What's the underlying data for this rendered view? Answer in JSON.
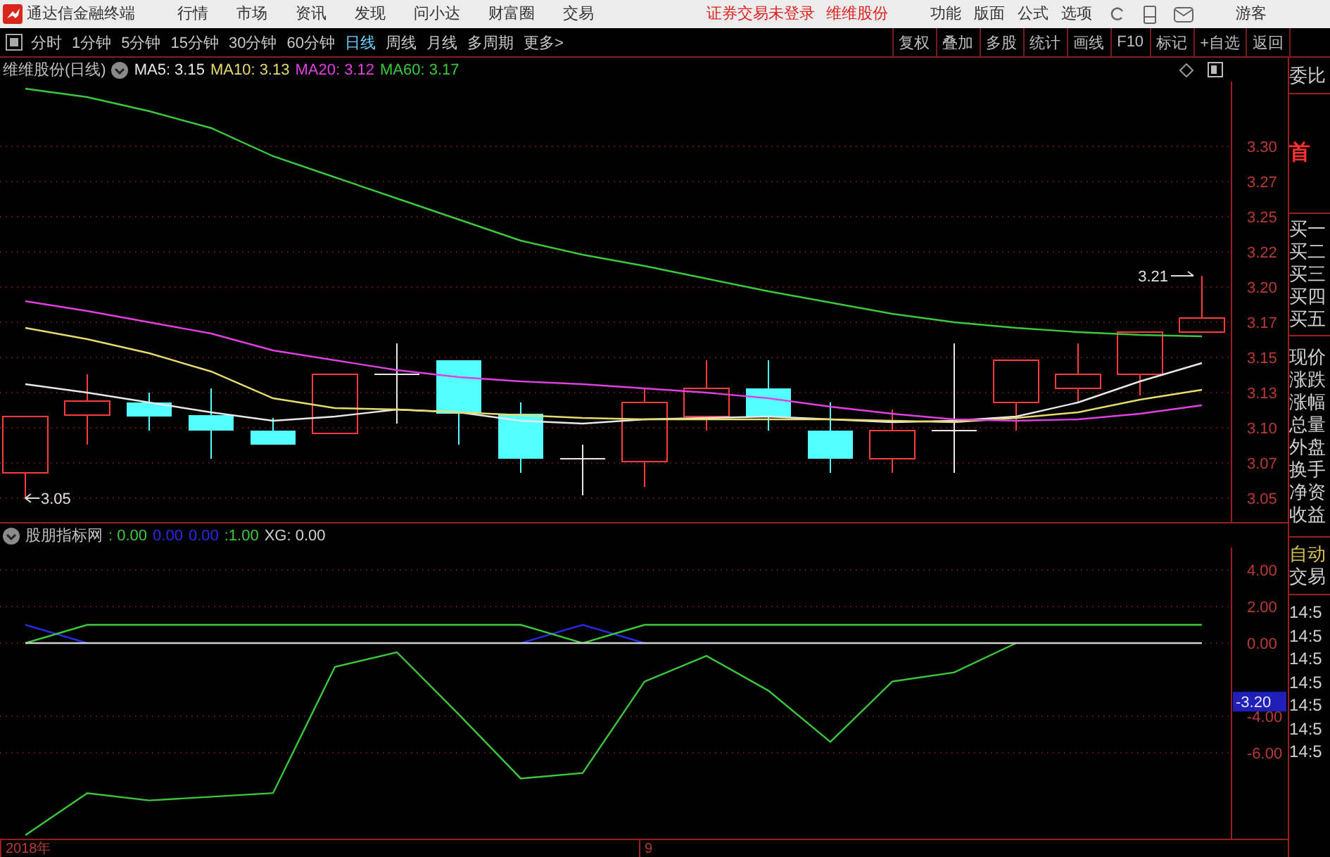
{
  "title_bar": {
    "app_name": "通达信金融终端",
    "menu": [
      "行情",
      "市场",
      "资讯",
      "发现",
      "问小达",
      "财富圈",
      "交易"
    ],
    "status": [
      "证券交易未登录",
      "维维股份"
    ],
    "right_menu": [
      "功能",
      "版面",
      "公式",
      "选项"
    ],
    "user": "游客"
  },
  "period_tabs": [
    {
      "label": "分时",
      "selected": false
    },
    {
      "label": "1分钟",
      "selected": false
    },
    {
      "label": "5分钟",
      "selected": false
    },
    {
      "label": "15分钟",
      "selected": false
    },
    {
      "label": "30分钟",
      "selected": false
    },
    {
      "label": "60分钟",
      "selected": false
    },
    {
      "label": "日线",
      "selected": true
    },
    {
      "label": "周线",
      "selected": false
    },
    {
      "label": "月线",
      "selected": false
    },
    {
      "label": "多周期",
      "selected": false
    },
    {
      "label": "更多>",
      "selected": false
    }
  ],
  "tool_buttons": [
    "复权",
    "叠加",
    "多股",
    "统计",
    "画线",
    "F10",
    "标记",
    "+自选",
    "返回"
  ],
  "price_panel": {
    "legend": {
      "title": "维维股份(日线)",
      "values": [
        ": 3.15",
        ": 3.13",
        ": 3.12",
        ": 3.17"
      ]
    },
    "chart_data": {
      "type": "line",
      "ylim": [
        3.033,
        3.346
      ],
      "grid": true,
      "yticks": [
        3.05,
        {
          "value": 3.075,
          "label": "3.07"
        },
        {
          "value": 3.1,
          "label": "3.10"
        },
        {
          "value": 3.125,
          "label": "3.13"
        },
        3.15,
        {
          "value": 3.175,
          "label": "3.17"
        },
        {
          "value": 3.2,
          "label": "3.20"
        },
        {
          "value": 3.225,
          "label": "3.22"
        },
        3.25,
        {
          "value": 3.275,
          "label": "3.27"
        },
        {
          "value": 3.3,
          "label": "3.30"
        }
      ],
      "series": [
        {
          "name": "MA5",
          "color": "#e8e8e8",
          "values": [
            3.131,
            3.125,
            3.118,
            3.111,
            3.105,
            3.108,
            3.113,
            3.111,
            3.105,
            3.103,
            3.106,
            3.107,
            3.108,
            3.106,
            3.104,
            3.105,
            3.108,
            3.118,
            3.133,
            3.146
          ]
        },
        {
          "name": "MA10",
          "color": "#e6dc6e",
          "values": [
            3.171,
            3.163,
            3.153,
            3.14,
            3.121,
            3.114,
            3.113,
            3.111,
            3.109,
            3.107,
            3.106,
            3.106,
            3.106,
            3.106,
            3.105,
            3.104,
            3.107,
            3.111,
            3.12,
            3.127
          ]
        },
        {
          "name": "MA20",
          "color": "#e040e0",
          "values": [
            3.19,
            3.183,
            3.175,
            3.167,
            3.155,
            3.148,
            3.141,
            3.136,
            3.133,
            3.131,
            3.128,
            3.125,
            3.121,
            3.115,
            3.11,
            3.106,
            3.105,
            3.106,
            3.11,
            3.116
          ]
        },
        {
          "name": "MA60",
          "color": "#3cc83c",
          "values": [
            3.341,
            3.335,
            3.325,
            3.313,
            3.293,
            3.278,
            3.263,
            3.248,
            3.233,
            3.223,
            3.215,
            3.206,
            3.197,
            3.189,
            3.181,
            3.175,
            3.171,
            3.168,
            3.166,
            3.165
          ]
        }
      ],
      "annotations": [
        {
          "text": "3.21"
        },
        {
          "text": "3.05"
        }
      ]
    }
  },
  "indicator_panel": {
    "legend": {
      "title": "股朋指标网",
      "items": [
        {
          "text": ": 0.00",
          "color": "#3cc83c"
        },
        {
          "text": "0.00",
          "color": "#2a2ae0"
        },
        {
          "text": "0.00",
          "color": "#2a2ae0"
        },
        {
          "text": ":1.00",
          "color": "#3cc83c"
        },
        {
          "text": "XG: 0.00",
          "color": "#d0d0d0"
        }
      ]
    },
    "chart_data": {
      "type": "line",
      "ylim": [
        -10.69,
        5.23
      ],
      "grid": true,
      "yticks": [
        {
          "value": -6,
          "label": "-6.00"
        },
        {
          "value": -4,
          "label": "-4.00"
        },
        {
          "value": 0,
          "label": "0.00"
        },
        {
          "value": 2,
          "label": "2.00"
        },
        {
          "value": 4,
          "label": "4.00"
        }
      ],
      "series": [
        {
          "color": "#3cc83c",
          "values": [
            -10.5,
            -8.2,
            -8.6,
            -8.4,
            -8.2,
            -1.3,
            -0.5,
            -3.9,
            -7.4,
            -7.1,
            -2.1,
            -0.7,
            -2.6,
            -5.4,
            -2.1,
            -1.6,
            0,
            null,
            null,
            null
          ]
        },
        {
          "color": "#2a2ae0",
          "values": [
            1,
            0,
            null,
            null,
            null,
            null,
            null,
            null,
            0,
            1,
            0,
            null,
            null,
            null,
            null,
            null,
            null,
            null,
            null,
            null
          ]
        },
        {
          "color": "#3cc83c",
          "values": [
            0,
            1,
            1,
            1,
            1,
            1,
            1,
            1,
            1,
            0,
            1,
            1,
            1,
            1,
            1,
            1,
            1,
            1,
            1,
            1
          ]
        },
        {
          "color": "#d0d0d0",
          "values": [
            0,
            0,
            0,
            0,
            0,
            0,
            0,
            0,
            0,
            0,
            0,
            0,
            0,
            0,
            0,
            0,
            0,
            0,
            0,
            0
          ]
        }
      ],
      "annotations": [
        {
          "text": "-3.20"
        }
      ]
    }
  },
  "date_labels": [
    "2018年",
    "9"
  ],
  "quote_panel": {
    "header": "委比",
    "stock_tag": "首",
    "bid_labels": [
      "买一",
      "买二",
      "买三",
      "买四",
      "买五"
    ],
    "quote_labels": [
      "现价",
      "涨跌",
      "涨幅",
      "总量",
      "外盘",
      "换手",
      "净资",
      "收益"
    ],
    "auto_label": "自动",
    "trade_label": "交易",
    "times": [
      "14:5",
      "14:5",
      "14:5",
      "14:5",
      "14:5",
      "14:5",
      "14:5"
    ]
  }
}
